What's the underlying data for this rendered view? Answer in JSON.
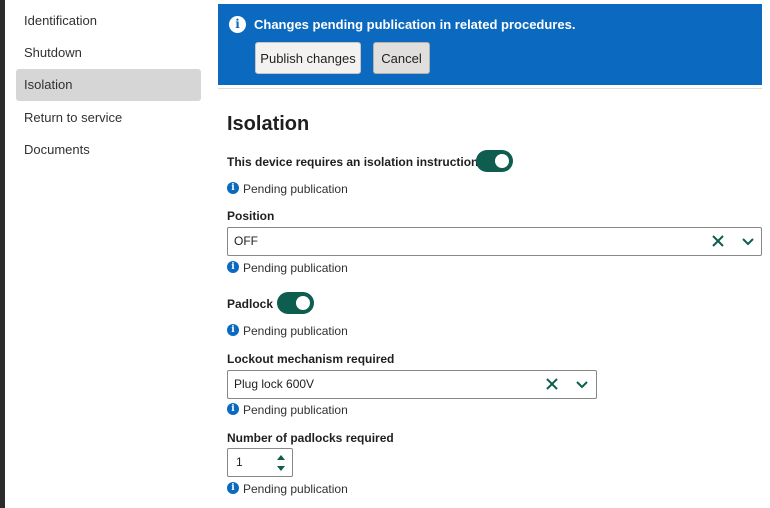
{
  "sidebar": {
    "items": [
      {
        "label": "Identification"
      },
      {
        "label": "Shutdown"
      },
      {
        "label": "Isolation"
      },
      {
        "label": "Return to service"
      },
      {
        "label": "Documents"
      }
    ],
    "active": "Isolation"
  },
  "banner": {
    "message": "Changes pending publication in related procedures.",
    "publish_label": "Publish changes",
    "cancel_label": "Cancel",
    "color": "#0b6abf"
  },
  "page": {
    "title": "Isolation"
  },
  "fields": {
    "isolation_instruction": {
      "label": "This device requires an isolation instruction",
      "enabled": true,
      "status": "Pending publication"
    },
    "position": {
      "label": "Position",
      "value": "OFF",
      "status": "Pending publication"
    },
    "padlock": {
      "label": "Padlock",
      "enabled": true,
      "status": "Pending publication"
    },
    "lockout_mechanism": {
      "label": "Lockout mechanism required",
      "value": "Plug lock 600V",
      "status": "Pending publication"
    },
    "padlock_count": {
      "label": "Number of padlocks required",
      "value": "1",
      "status": "Pending publication"
    }
  },
  "icons": {
    "info": "info-icon",
    "clear": "close-icon",
    "chevron": "chevron-down-icon",
    "step_up": "caret-up-icon",
    "step_down": "caret-down-icon"
  },
  "colors": {
    "toggle_on": "#0e5d4f",
    "info": "#0b6abf",
    "active_nav": "#d6d6d6"
  }
}
